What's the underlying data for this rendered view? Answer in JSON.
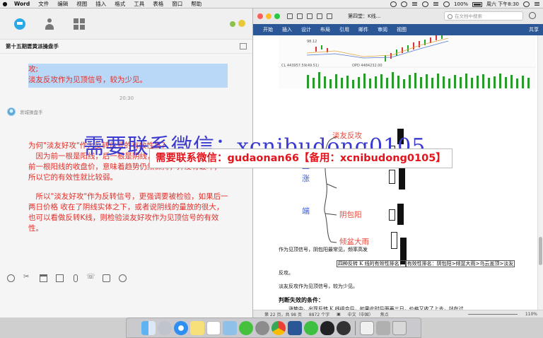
{
  "menubar": {
    "app": "Word",
    "items": [
      "文件",
      "编辑",
      "视图",
      "插入",
      "格式",
      "工具",
      "表格",
      "窗口",
      "帮助"
    ],
    "battery": "100%",
    "clock": "周六 下午8:30"
  },
  "chat": {
    "group_title": "第十五期匮黄派操盘手",
    "msg1_lines": [
      "攻;",
      "淡友反攻作为见顶信号，较为少见。"
    ],
    "timestamp": "20:30",
    "sender": "衷城操盘手",
    "msg2_paragraphs": [
      "为何\"淡友好攻\"作为反转信号的有效性高？\n　因为前一根是阳线，后一根是阴线，收盘价毕竟没有跌破前一根阳线的收盘价，意味着趋势仍然保持，并没有破坏，所以它的有效性就比较弱。",
      "　所以\"淡友好攻\"作为反转信号，更强调要被检验，如果后一两日价格 收在了阴线实体之下，或者说阴线的量放的很大，也可以看做反转K线，则检验淡友好攻作为见顶信号的有效性。"
    ],
    "toolbar_icons": [
      "smile-icon",
      "scissors-icon",
      "folder-icon",
      "image-icon",
      "mic-icon",
      "phone-icon",
      "video-icon",
      "more-icon"
    ]
  },
  "word": {
    "doc_title": "第四堂：K线...",
    "search_placeholder": "在文档中搜索",
    "ribbon_tabs": [
      "开始",
      "插入",
      "设计",
      "布局",
      "引用",
      "邮件",
      "审阅",
      "视图"
    ],
    "share": "共享",
    "chart_labels": {
      "l1": "CL  443957.59(49.51)",
      "l2": "OPD  4484232.00",
      "l3": "98.12"
    },
    "diagram": {
      "vertical_left": "上",
      "vertical_left2": "涨",
      "vertical_bottom": "端",
      "labels": [
        "淡友反攻",
        "阴包阳",
        "倾盆大雨"
      ]
    },
    "lines": {
      "l1": "作为见顶信号，阴包阳最常见，频率高发",
      "l2a": "四种反转 K 线的有效性排名：",
      "l2b": "有效性排名：阴包阳>倾盆大雨>乌云盖顶>淡友",
      "l3": "反攻。",
      "l4": "淡友反攻作为见顶信号，较为少见。",
      "l5": "判断失效的条件：",
      "l6": "　　涨势中，出现反转 K 线组合后，如果此时后面再三日，价格又收了上去，站在过"
    },
    "status": {
      "page": "第 22 页，共 98 页",
      "words": "8872 个字",
      "lang": "中文（中国）",
      "mode": "焦点",
      "zoom": "110%"
    }
  },
  "watermark": {
    "big": "需要联系微信：xcnibudong0105",
    "box": "需要联系微信：gudaonan66【备用：xcnibudong0105】"
  },
  "dock": {
    "icons": [
      "finder-icon",
      "launchpad-icon",
      "safari-icon",
      "notes-icon",
      "calendar-icon",
      "preview-icon",
      "wechat-icon",
      "system-prefs-icon",
      "chrome-icon",
      "word-icon",
      "wechat2-icon",
      "qq-icon",
      "obs-icon",
      "textedit-icon",
      "photos-icon",
      "trash-icon"
    ]
  }
}
